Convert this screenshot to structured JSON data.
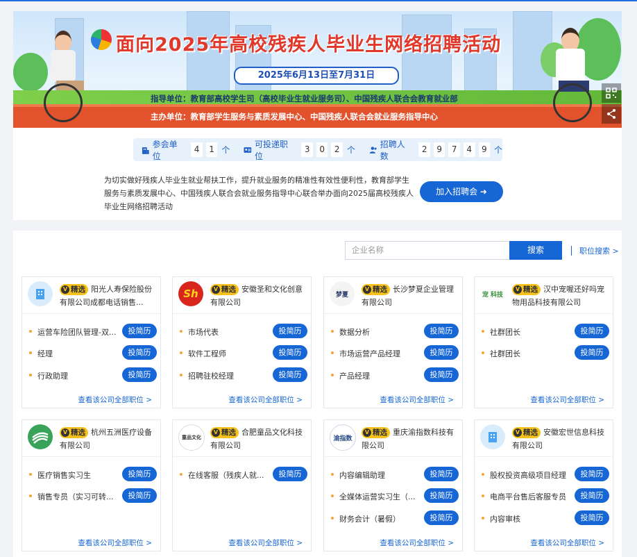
{
  "banner": {
    "title": "面向2025年高校残疾人毕业生网络招聘活动",
    "date": "2025年6月13日至7月31日",
    "guide": "指导单位：教育部高校学生司（高校毕业生就业服务司）、中国残疾人联合会教育就业部",
    "host": "主办单位：教育部学生服务与素质发展中心、中国残疾人联合会就业服务指导中心"
  },
  "stats": [
    {
      "label": "参会单位",
      "digits": [
        "4",
        "1"
      ],
      "unit": "个",
      "icon": "building-icon"
    },
    {
      "label": "可投递职位",
      "digits": [
        "3",
        "0",
        "2"
      ],
      "unit": "个",
      "icon": "id-card-icon"
    },
    {
      "label": "招聘人数",
      "digits": [
        "2",
        "9",
        "7",
        "4",
        "9"
      ],
      "unit": "个",
      "icon": "people-icon"
    }
  ],
  "description": "为切实做好残疾人毕业生就业帮扶工作，提升就业服务的精准性有效性便利性，教育部学生服务与素质发展中心、中国残疾人联合会就业服务指导中心联合举办面向2025届高校残疾人毕业生网络招聘活动",
  "join_button": "加入招聘会 ➜",
  "search": {
    "placeholder": "企业名称",
    "button": "搜索",
    "job_search": "职位搜索 >"
  },
  "badge": "精选",
  "badge_v": "V",
  "apply_label": "投简历",
  "more_label": "查看该公司全部职位 >",
  "companies": [
    {
      "name": "阳光人寿保险股份有限公司成都电话销售...",
      "logo": "building-logo",
      "logo_text": "",
      "jobs": [
        "运营车险团队管理-双...",
        "经理",
        "行政助理"
      ]
    },
    {
      "name": "安徽圣和文化创意有限公司",
      "logo": "sh-logo",
      "logo_text": "Sh",
      "jobs": [
        "市场代表",
        "软件工程师",
        "招聘驻校经理"
      ]
    },
    {
      "name": "长沙梦夏企业管理有限公司",
      "logo": "mengxia-logo",
      "logo_text": "梦夏",
      "jobs": [
        "数据分析",
        "市场运营产品经理",
        "产品经理"
      ]
    },
    {
      "name": "汉中宠喔还好吗宠物用品科技有限公司",
      "logo": "pet-logo",
      "logo_text": "宠 科技",
      "jobs": [
        "社群团长",
        "社群团长"
      ]
    },
    {
      "name": "杭州五洲医疗设备有限公司",
      "logo": "wuzhou-logo",
      "logo_text": "",
      "jobs": [
        "医疗销售实习生",
        "销售专员（实习可转..."
      ]
    },
    {
      "name": "合肥童品文化科技有限公司",
      "logo": "tongpin-logo",
      "logo_text": "童品文化",
      "jobs": [
        "在线客服（残疾人就..."
      ]
    },
    {
      "name": "重庆渝指数科技有限公司",
      "logo": "yuzhishu-logo",
      "logo_text": "渝指数",
      "jobs": [
        "内容编辑助理",
        "全媒体运营实习生（...",
        "财务会计（暑假）"
      ]
    },
    {
      "name": "安徽宏世信息科技有限公司",
      "logo": "building-logo",
      "logo_text": "",
      "jobs": [
        "股权投资高级项目经理",
        "电商平台售后客服专员",
        "内容审核"
      ]
    }
  ]
}
